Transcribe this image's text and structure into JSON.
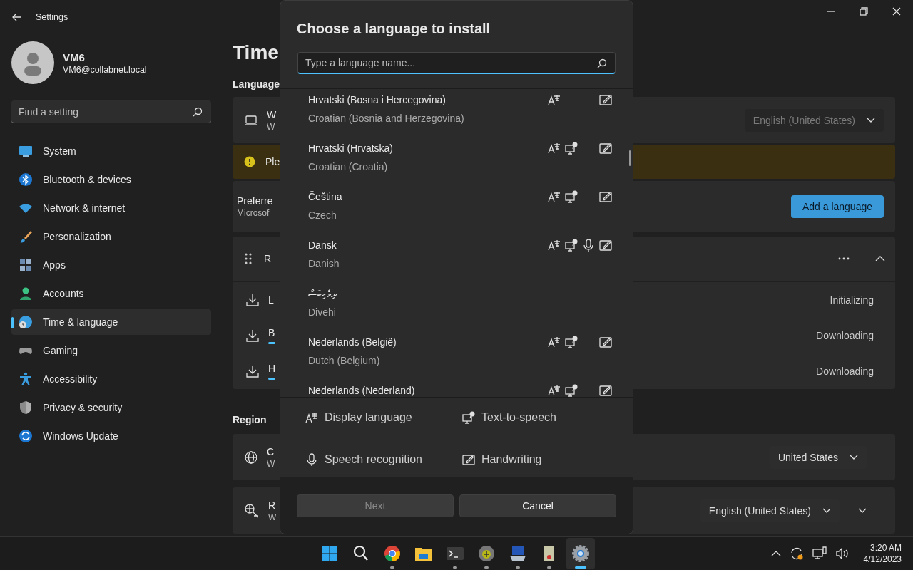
{
  "window": {
    "title": "Settings"
  },
  "user": {
    "name": "VM6",
    "email": "VM6@collabnet.local"
  },
  "search": {
    "placeholder": "Find a setting"
  },
  "nav": [
    {
      "label": "System",
      "selected": false
    },
    {
      "label": "Bluetooth & devices",
      "selected": false
    },
    {
      "label": "Network & internet",
      "selected": false
    },
    {
      "label": "Personalization",
      "selected": false
    },
    {
      "label": "Apps",
      "selected": false
    },
    {
      "label": "Accounts",
      "selected": false
    },
    {
      "label": "Time & language",
      "selected": true
    },
    {
      "label": "Gaming",
      "selected": false
    },
    {
      "label": "Accessibility",
      "selected": false
    },
    {
      "label": "Privacy & security",
      "selected": false
    },
    {
      "label": "Windows Update",
      "selected": false
    }
  ],
  "page": {
    "title": "Time"
  },
  "language_section": {
    "heading": "Language",
    "display_row": {
      "title": "W",
      "subtitle": "W",
      "dropdown": "English (United States)",
      "disabled": true
    },
    "warning": {
      "text": "Ple"
    },
    "preferred": {
      "title": "Preferre",
      "subtitle": "Microsof",
      "button": "Add a language"
    },
    "pack": {
      "title": "R",
      "expanded": true,
      "downloads": [
        {
          "label": "L",
          "status": "Initializing",
          "progress": false
        },
        {
          "label": "B",
          "status": "Downloading",
          "progress": true
        },
        {
          "label": "H",
          "status": "Downloading",
          "progress": true
        }
      ]
    }
  },
  "region_section": {
    "heading": "Region",
    "rows": [
      {
        "title": "C",
        "subtitle": "W",
        "dropdown": "United States",
        "expandable": false
      },
      {
        "title": "R",
        "subtitle": "W",
        "dropdown": "English (United States)",
        "expandable": true
      }
    ]
  },
  "dialog": {
    "title": "Choose a language to install",
    "search": {
      "placeholder": "Type a language name..."
    },
    "languages": [
      {
        "native": "Hrvatski (Bosna i Hercegovina)",
        "english": "Croatian (Bosnia and Herzegovina)",
        "display": true,
        "tts": false,
        "speech": false,
        "handwriting": true
      },
      {
        "native": "Hrvatski (Hrvatska)",
        "english": "Croatian (Croatia)",
        "display": true,
        "tts": true,
        "speech": false,
        "handwriting": true
      },
      {
        "native": "Čeština",
        "english": "Czech",
        "display": true,
        "tts": true,
        "speech": false,
        "handwriting": true
      },
      {
        "native": "Dansk",
        "english": "Danish",
        "display": true,
        "tts": true,
        "speech": true,
        "handwriting": true
      },
      {
        "native": "ދިވެހިބަސް",
        "english": "Divehi",
        "display": false,
        "tts": false,
        "speech": false,
        "handwriting": false
      },
      {
        "native": "Nederlands (België)",
        "english": "Dutch (Belgium)",
        "display": true,
        "tts": true,
        "speech": false,
        "handwriting": true
      },
      {
        "native": "Nederlands (Nederland)",
        "display": true,
        "tts": true,
        "speech": false,
        "handwriting": true
      }
    ],
    "legend": [
      {
        "label": "Display language"
      },
      {
        "label": "Text-to-speech"
      },
      {
        "label": "Speech recognition"
      },
      {
        "label": "Handwriting"
      }
    ],
    "buttons": [
      {
        "label": "Next",
        "disabled": true
      },
      {
        "label": "Cancel",
        "disabled": false
      }
    ]
  },
  "taskbar": {
    "apps": [
      {
        "running": false,
        "active": false
      },
      {
        "running": false,
        "active": false
      },
      {
        "running": true,
        "active": false
      },
      {
        "running": false,
        "active": false
      },
      {
        "running": true,
        "active": false
      },
      {
        "running": true,
        "active": false
      },
      {
        "running": true,
        "active": false
      },
      {
        "running": true,
        "active": false
      },
      {
        "running": false,
        "active": true
      }
    ],
    "time": "3:20 AM",
    "date": "4/12/2023"
  }
}
